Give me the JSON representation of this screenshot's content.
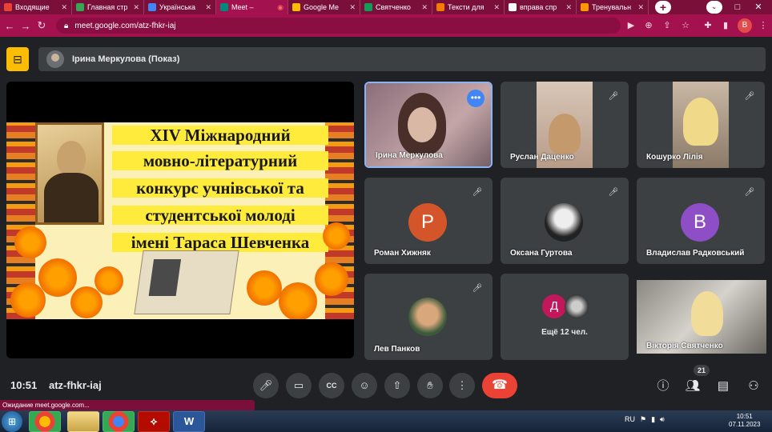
{
  "browser": {
    "tabs": [
      {
        "label": "Входящие",
        "color": "#ea4335"
      },
      {
        "label": "Главная стр",
        "color": "#34a853"
      },
      {
        "label": "Українська",
        "color": "#4285f4"
      },
      {
        "label": "Meet –",
        "color": "#00897b",
        "active": true
      },
      {
        "label": "Google Me",
        "color": "#fbbc04"
      },
      {
        "label": "Святченко",
        "color": "#0f9d58"
      },
      {
        "label": "Тексти для",
        "color": "#f57c00"
      },
      {
        "label": "вправа спр",
        "color": "#ffffff"
      },
      {
        "label": "Тренувальн",
        "color": "#ff9800"
      }
    ],
    "url": "meet.google.com/atz-fhkr-iaj",
    "profile_letter": "B"
  },
  "meet": {
    "presenter_label": "Ірина Меркулова (Показ)",
    "slide": {
      "lines": [
        "XIV Міжнародний",
        "мовно-літературний",
        "конкурс учнівської та",
        "студентської молоді",
        "імені Тараса Шевченка"
      ]
    },
    "participants": [
      {
        "name": "Ірина Меркулова",
        "kind": "video",
        "speaking": true
      },
      {
        "name": "Руслан Даценко",
        "kind": "video",
        "muted": true
      },
      {
        "name": "Кошурко Лілія",
        "kind": "video",
        "muted": true
      },
      {
        "name": "Роман Хижняк",
        "kind": "letter",
        "letter": "Р",
        "color": "#d4552a",
        "muted": true
      },
      {
        "name": "Оксана Гуртова",
        "kind": "photo",
        "muted": true
      },
      {
        "name": "Владислав Радковський",
        "kind": "letter",
        "letter": "В",
        "color": "#8e4ec6",
        "muted": true
      },
      {
        "name": "Лев Панков",
        "kind": "photo",
        "muted": true
      },
      {
        "name": "Вікторія Святченко",
        "kind": "video"
      }
    ],
    "others": {
      "letter": "Д",
      "letter_color": "#c2185b",
      "label": "Ещё 12 чел."
    },
    "time": "10:51",
    "meeting_code": "atz-fhkr-iaj",
    "participant_count": "21",
    "status_text": "Ожидание meet.google.com..."
  },
  "taskbar": {
    "lang": "RU",
    "time": "10:51",
    "date": "07.11.2023",
    "apps": [
      {
        "name": "chrome-icon",
        "glyph": ""
      },
      {
        "name": "explorer-icon",
        "glyph": ""
      },
      {
        "name": "chrome-profile-icon",
        "glyph": ""
      },
      {
        "name": "acrobat-icon",
        "glyph": ""
      },
      {
        "name": "word-icon",
        "glyph": "W"
      }
    ]
  }
}
